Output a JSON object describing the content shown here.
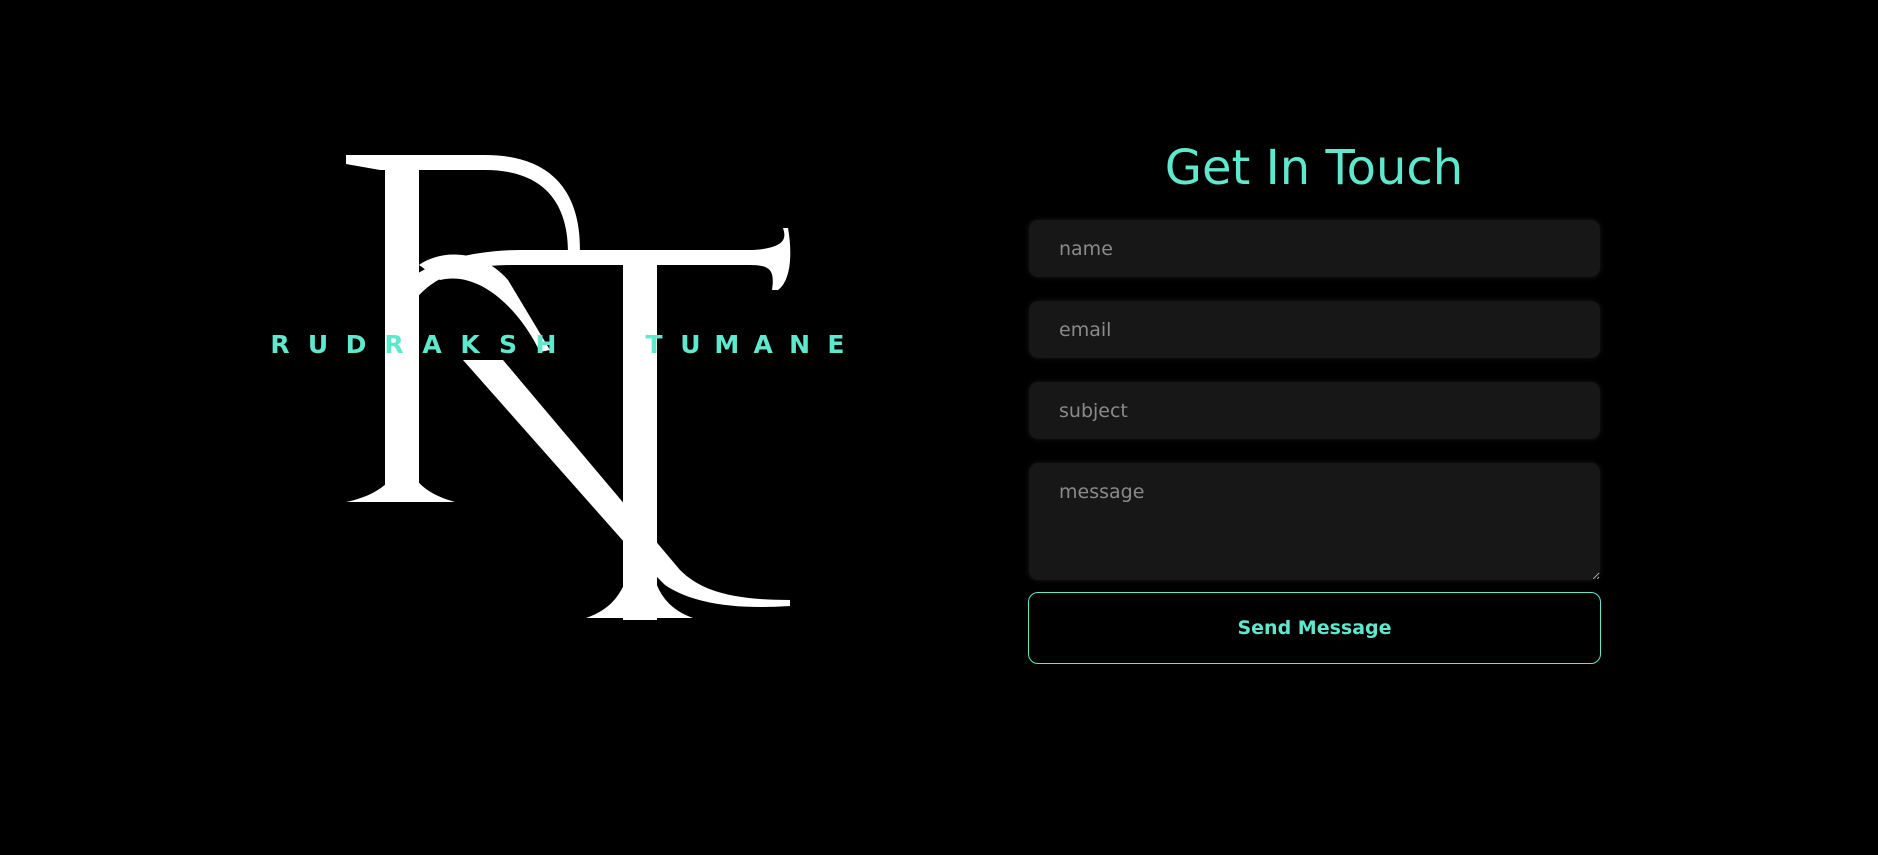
{
  "logo": {
    "name_first": [
      "R",
      "U",
      "D",
      "R",
      "A",
      "K",
      "S",
      "H"
    ],
    "name_last": [
      "T",
      "U",
      "M",
      "A",
      "N",
      "E"
    ],
    "monogram_color": "#ffffff",
    "accent_color": "#5ee9cf"
  },
  "contact": {
    "title": "Get In Touch",
    "name_placeholder": "name",
    "email_placeholder": "email",
    "subject_placeholder": "subject",
    "message_placeholder": "message",
    "send_label": "Send Message"
  }
}
